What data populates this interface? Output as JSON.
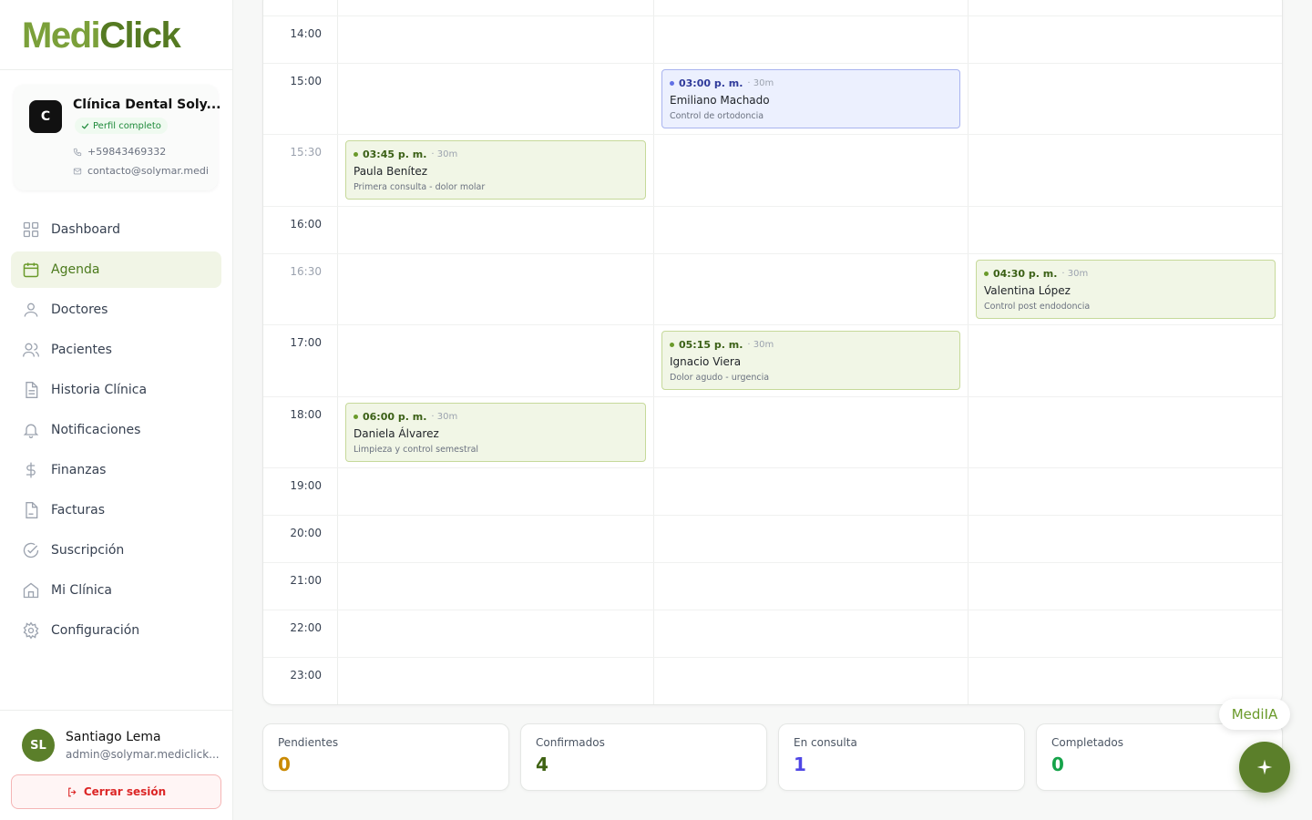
{
  "app": {
    "logo_medi": "Medi",
    "logo_click": "Click"
  },
  "clinic": {
    "avatar_letter": "C",
    "name": "Clínica Dental Soly...",
    "badge": "Perfil completo",
    "phone": "+59843469332",
    "email": "contacto@solymar.medi"
  },
  "nav": {
    "items": [
      {
        "label": "Dashboard",
        "icon": "grid-icon"
      },
      {
        "label": "Agenda",
        "icon": "calendar-icon",
        "active": true
      },
      {
        "label": "Doctores",
        "icon": "user-icon"
      },
      {
        "label": "Pacientes",
        "icon": "users-icon"
      },
      {
        "label": "Historia Clínica",
        "icon": "file-icon"
      },
      {
        "label": "Notificaciones",
        "icon": "bell-icon"
      },
      {
        "label": "Finanzas",
        "icon": "dollar-icon"
      },
      {
        "label": "Facturas",
        "icon": "invoice-icon"
      },
      {
        "label": "Suscripción",
        "icon": "check-circle-icon"
      },
      {
        "label": "Mi Clínica",
        "icon": "home-icon"
      },
      {
        "label": "Configuración",
        "icon": "gear-icon"
      }
    ]
  },
  "user": {
    "initials": "SL",
    "name": "Santiago Lema",
    "email": "admin@solymar.mediclick...",
    "logout_label": "Cerrar sesión"
  },
  "calendar": {
    "time_slots": [
      "14:00",
      "15:00",
      "15:30",
      "16:00",
      "16:30",
      "17:00",
      "18:00",
      "19:00",
      "20:00",
      "21:00",
      "22:00",
      "23:00"
    ],
    "events": [
      {
        "time": "03:00 p. m.",
        "duration": "· 30m",
        "patient": "Emiliano Machado",
        "note": "Control de ortodoncia",
        "color": "blue",
        "status": "En consulta"
      },
      {
        "time": "03:45 p. m.",
        "duration": "· 30m",
        "patient": "Paula Benítez",
        "note": "Primera consulta - dolor molar",
        "color": "green",
        "status": "Confirmado"
      },
      {
        "time": "04:30 p. m.",
        "duration": "· 30m",
        "patient": "Valentina López",
        "note": "Control post endodoncia",
        "color": "green",
        "status": "Confirmado"
      },
      {
        "time": "05:15 p. m.",
        "duration": "· 30m",
        "patient": "Ignacio Viera",
        "note": "Dolor agudo - urgencia",
        "color": "green",
        "status": "Confirmado"
      },
      {
        "time": "06:00 p. m.",
        "duration": "· 30m",
        "patient": "Daniela Álvarez",
        "note": "Limpieza y control semestral",
        "color": "green",
        "status": "Confirmado"
      }
    ]
  },
  "stats": [
    {
      "label": "Pendientes",
      "value": "0",
      "color": "#ca8a04"
    },
    {
      "label": "Confirmados",
      "value": "4",
      "color": "#3f6212"
    },
    {
      "label": "En consulta",
      "value": "1",
      "color": "#4f46e5"
    },
    {
      "label": "Completados",
      "value": "0",
      "color": "#16a34a"
    }
  ],
  "assistant": {
    "label": "MediIA",
    "fab_icon": "sparkle-icon"
  },
  "colors": {
    "brand": "#5b7f2a",
    "brand_light": "#7ba03a",
    "danger": "#dc2626"
  }
}
